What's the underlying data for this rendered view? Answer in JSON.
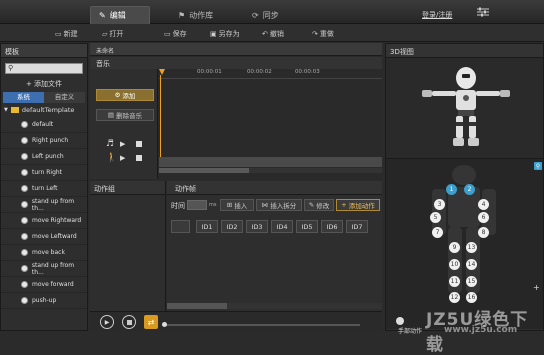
{
  "top_tabs": {
    "edit": "编辑",
    "library": "动作库",
    "sync": "同步"
  },
  "login": "登录/注册",
  "toolbar": {
    "new": "新建",
    "open": "打开",
    "save": "保存",
    "save_as": "另存为",
    "undo": "撤销",
    "redo": "重做"
  },
  "sidebar": {
    "title": "模板",
    "add_file": "添加文件",
    "tab_system": "系统",
    "tab_custom": "自定义",
    "root": "defaultTemplate",
    "items": [
      "default",
      "Right punch",
      "Left punch",
      "turn Right",
      "turn Left",
      "stand up from th...",
      "move Rightward",
      "move Leftward",
      "move back",
      "stand up from th...",
      "move forward",
      "push-up"
    ]
  },
  "center": {
    "file_name": "未命名",
    "music_title": "音乐",
    "add_btn": "添加",
    "del_music_btn": "删除音乐",
    "ruler": [
      "00:00:01",
      "00:00:02",
      "00:00:03"
    ],
    "group_title": "动作组",
    "frame_title": "动作帧",
    "time_label": "时间",
    "time_unit": "ms",
    "insert": "插入",
    "insert_split": "插入拆分",
    "modify": "修改",
    "add_action": "添加动作",
    "ids": [
      "ID1",
      "ID2",
      "ID3",
      "ID4",
      "ID5",
      "ID6",
      "ID7"
    ]
  },
  "right": {
    "title": "3D视图",
    "hand_label": "手部动作",
    "watermark": "JZ5U绿色下载",
    "watermark_url": "www.jz5u.com",
    "joints": [
      "1",
      "2",
      "3",
      "4",
      "5",
      "6",
      "7",
      "8",
      "9",
      "10",
      "11",
      "12",
      "13",
      "14",
      "15",
      "16"
    ]
  },
  "colors": {
    "accent": "#f0a020",
    "timeline_bg": "#4a4a4a",
    "playhead": "#f0a020"
  }
}
